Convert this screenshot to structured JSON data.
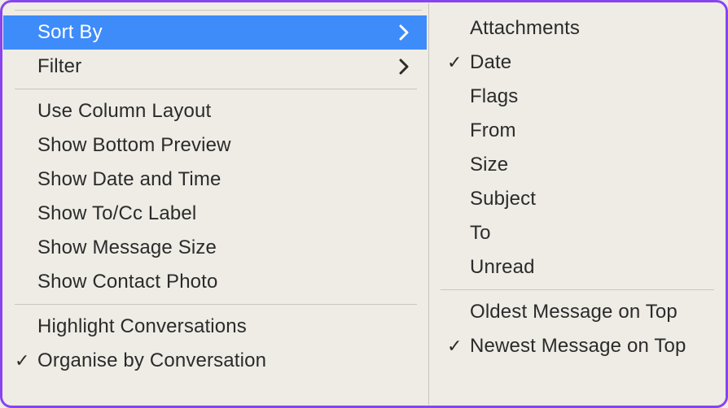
{
  "left_menu": {
    "section1": {
      "sort_by": {
        "label": "Sort By",
        "has_submenu": true,
        "highlighted": true,
        "checked": false
      },
      "filter": {
        "label": "Filter",
        "has_submenu": true,
        "highlighted": false,
        "checked": false
      }
    },
    "section2": {
      "use_column_layout": {
        "label": "Use Column Layout",
        "checked": false
      },
      "show_bottom_preview": {
        "label": "Show Bottom Preview",
        "checked": false
      },
      "show_date_time": {
        "label": "Show Date and Time",
        "checked": false
      },
      "show_to_cc": {
        "label": "Show To/Cc Label",
        "checked": false
      },
      "show_message_size": {
        "label": "Show Message Size",
        "checked": false
      },
      "show_contact_photo": {
        "label": "Show Contact Photo",
        "checked": false
      }
    },
    "section3": {
      "highlight_conversations": {
        "label": "Highlight Conversations",
        "checked": false
      },
      "organise_by_conversation": {
        "label": "Organise by Conversation",
        "checked": true
      }
    }
  },
  "submenu": {
    "criteria": {
      "attachments": {
        "label": "Attachments",
        "checked": false
      },
      "date": {
        "label": "Date",
        "checked": true
      },
      "flags": {
        "label": "Flags",
        "checked": false
      },
      "from": {
        "label": "From",
        "checked": false
      },
      "size": {
        "label": "Size",
        "checked": false
      },
      "subject": {
        "label": "Subject",
        "checked": false
      },
      "to": {
        "label": "To",
        "checked": false
      },
      "unread": {
        "label": "Unread",
        "checked": false
      }
    },
    "order": {
      "oldest_top": {
        "label": "Oldest Message on Top",
        "checked": false
      },
      "newest_top": {
        "label": "Newest Message on Top",
        "checked": true
      }
    }
  },
  "glyphs": {
    "check": "✓"
  },
  "colors": {
    "highlight": "#3e8cfa"
  }
}
